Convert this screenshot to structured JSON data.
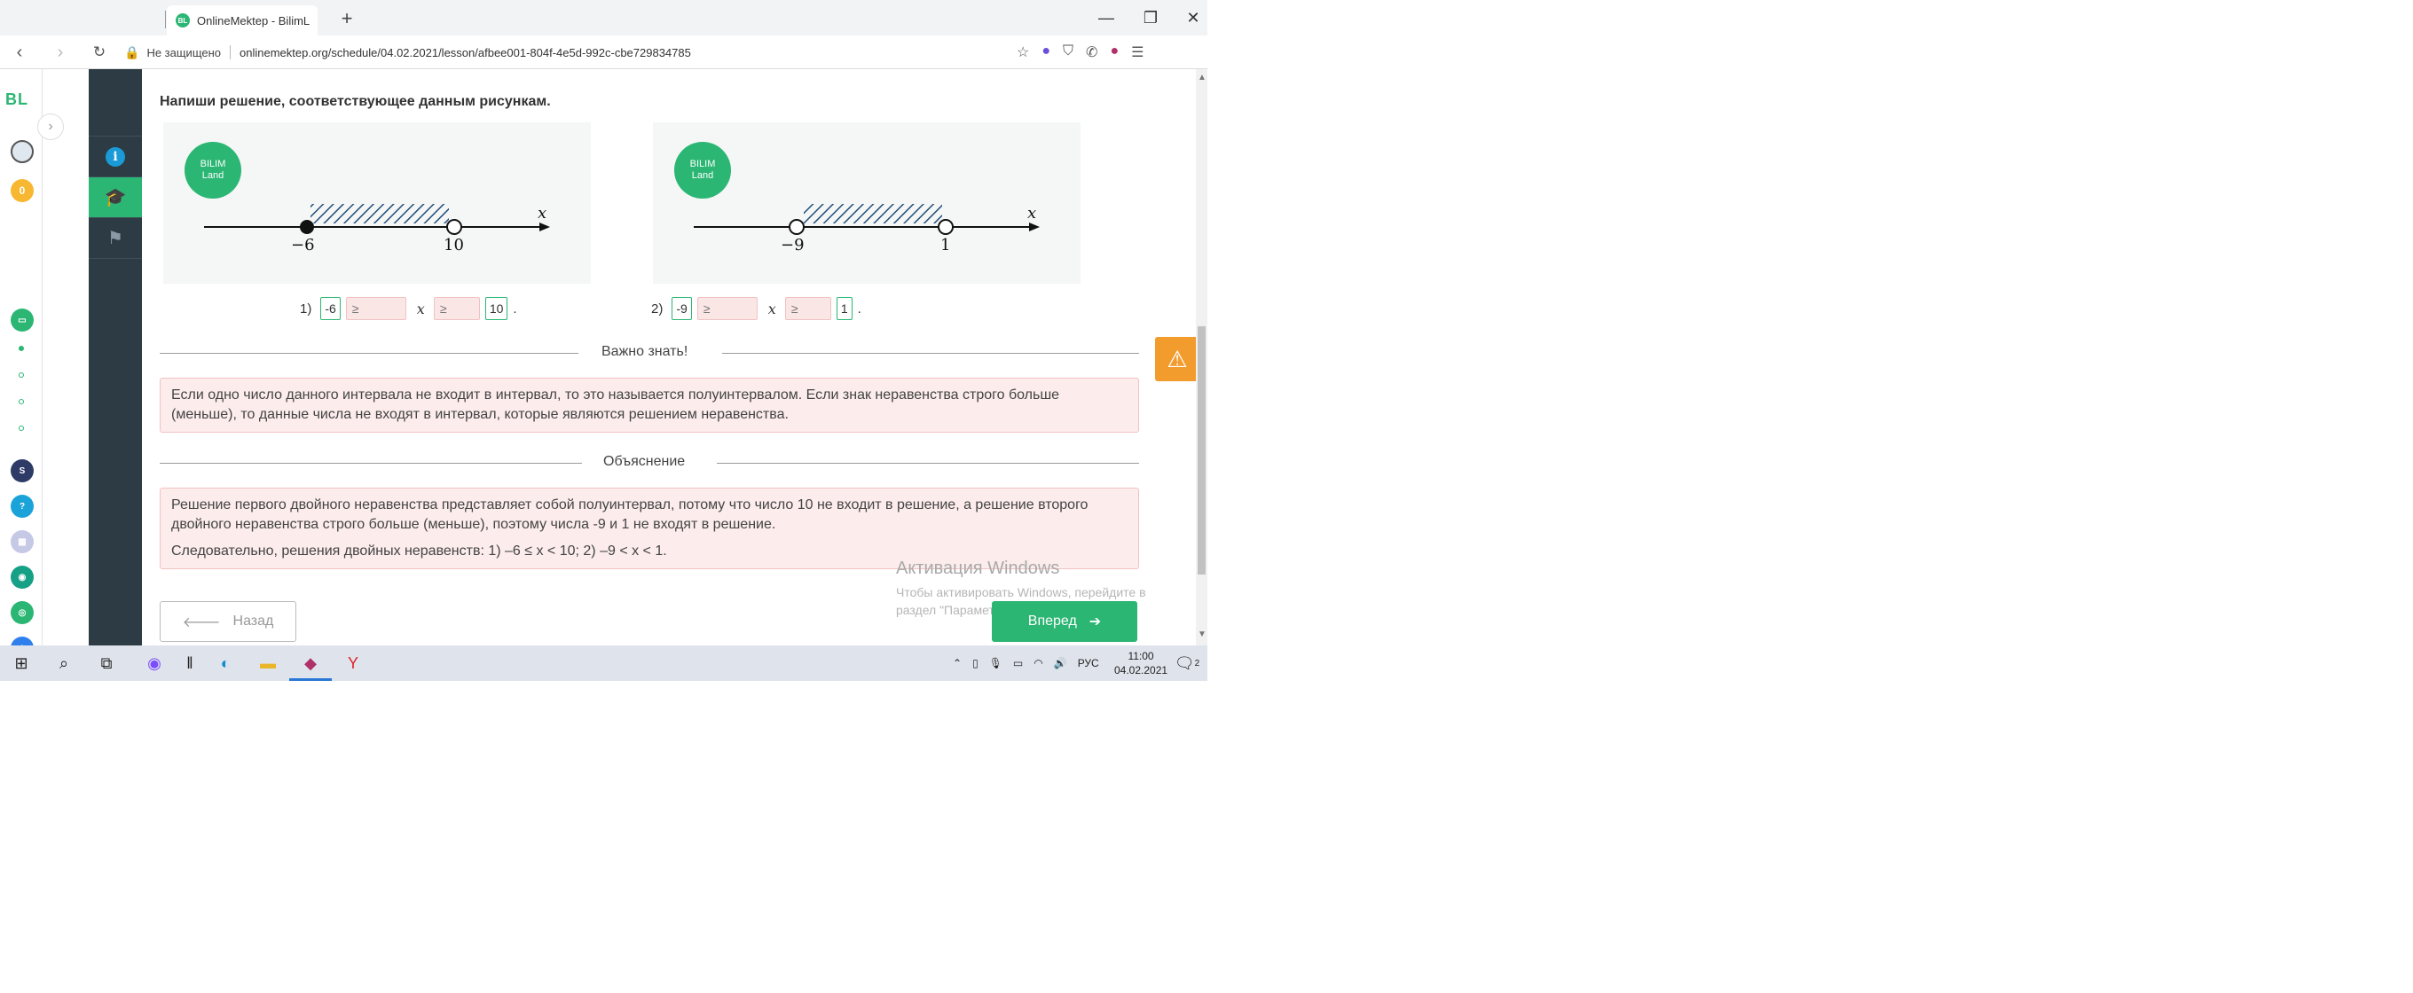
{
  "browser": {
    "tab_title": "OnlineMektep - BilimL",
    "tab_logo": "BL",
    "new_tab": "+",
    "insecure_label": "Не защищено",
    "url": "onlinemektep.org/schedule/04.02.2021/lesson/afbee001-804f-4e5d-992c-cbe729834785"
  },
  "left_strip": {
    "logo": "BL",
    "coins": "0"
  },
  "lesson": {
    "instruction": "Напиши решение, соответствующее данным рисункам.",
    "bilim_logo_line1": "BILIM",
    "bilim_logo_line2": "Land",
    "figure1": {
      "left_label": "−6",
      "right_label": "10",
      "axis_var": "x",
      "left_closed": true,
      "right_closed": false
    },
    "figure2": {
      "left_label": "−9",
      "right_label": "1",
      "axis_var": "x",
      "left_closed": false,
      "right_closed": false
    },
    "answer1": {
      "num": "1)",
      "left": "-6",
      "op1": "≥",
      "var": "x",
      "op2": "≥",
      "right": "10",
      "end": "."
    },
    "answer2": {
      "num": "2)",
      "left": "-9",
      "op1": "≥",
      "var": "x",
      "op2": "≥",
      "right": "1",
      "end": "."
    },
    "important_title": "Важно знать!",
    "important_text": "Если одно число данного интервала не входит в интервал, то это называется полуинтервалом. Если знак неравенства строго больше (меньше), то данные числа не входят в интервал, которые являются решением неравенства.",
    "explanation_title": "Объяснение",
    "explanation_text1": "Решение первого двойного неравенства представляет собой полуинтервал, потому что число 10 не входит в решение, а решение второго двойного неравенства строго больше (меньше), поэтому числа -9 и 1 не входят в решение.",
    "explanation_text2": "Следовательно, решения двойных неравенств: 1) –6 ≤ x < 10; 2) –9 < x < 1.",
    "back_label": "Назад",
    "next_label": "Вперед"
  },
  "watermark": {
    "title": "Активация Windows",
    "subtitle": "Чтобы активировать Windows, перейдите в раздел \"Парамет"
  },
  "taskbar": {
    "lang": "РУС",
    "time": "11:00",
    "date": "04.02.2021",
    "notif_count": "2"
  },
  "colors": {
    "accent": "#2bb673",
    "sidebar_dark": "#2d3b45",
    "warning": "#f39c2e",
    "note_bg": "#fcecec"
  }
}
